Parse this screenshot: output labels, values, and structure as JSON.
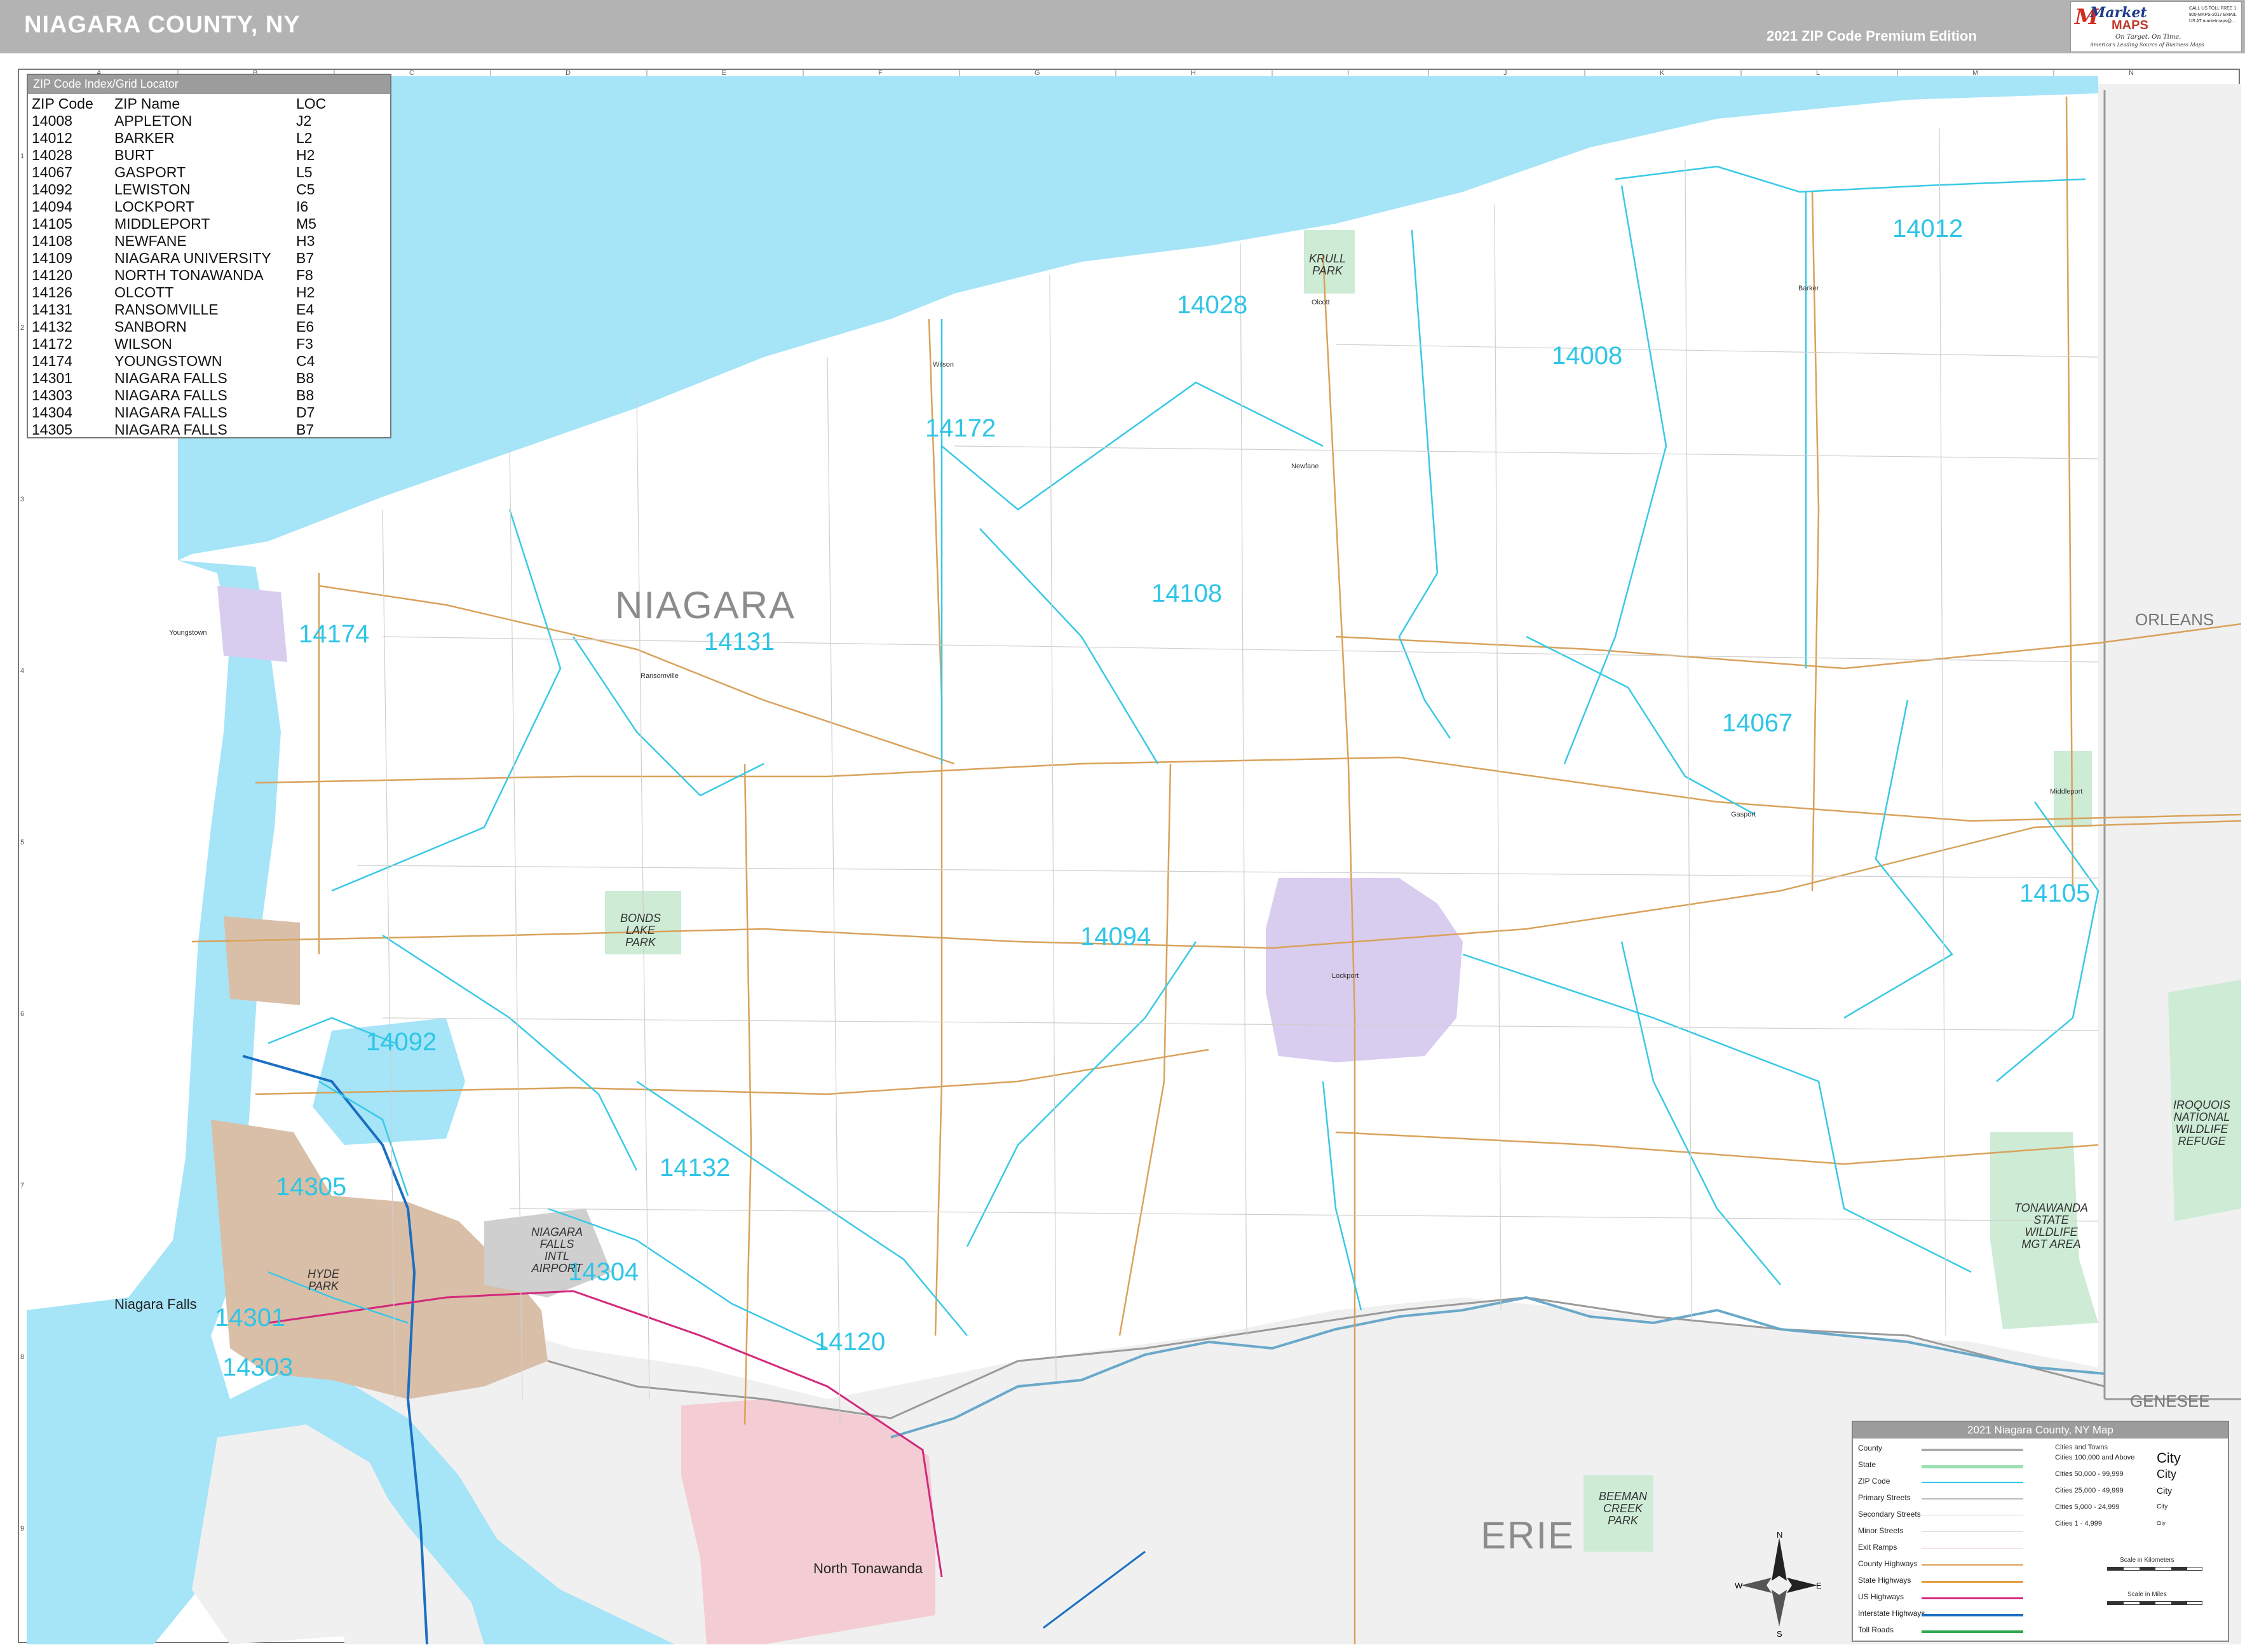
{
  "header": {
    "title": "NIAGARA COUNTY, NY",
    "edition": "2021 ZIP Code Premium Edition"
  },
  "logo": {
    "brand_line1": "Market",
    "brand_line2": "MAPS",
    "tagline": "On Target. On Time.",
    "tagline2": "America's Leading Source of Business Maps",
    "contact": "CALL US TOLL FREE 1-800-MAPS-2017 EMAIL US AT marketmaps@..."
  },
  "grid": {
    "columns": [
      "A",
      "B",
      "C",
      "D",
      "E",
      "F",
      "G",
      "H",
      "I",
      "J",
      "K",
      "L",
      "M",
      "N"
    ],
    "rows": [
      "1",
      "2",
      "3",
      "4",
      "5",
      "6",
      "7",
      "8",
      "9"
    ]
  },
  "zip_index": {
    "title": "ZIP Code Index/Grid Locator",
    "headers": [
      "ZIP Code",
      "ZIP Name",
      "LOC"
    ],
    "rows": [
      [
        "14008",
        "APPLETON",
        "J2"
      ],
      [
        "14012",
        "BARKER",
        "L2"
      ],
      [
        "14028",
        "BURT",
        "H2"
      ],
      [
        "14067",
        "GASPORT",
        "L5"
      ],
      [
        "14092",
        "LEWISTON",
        "C5"
      ],
      [
        "14094",
        "LOCKPORT",
        "I6"
      ],
      [
        "14105",
        "MIDDLEPORT",
        "M5"
      ],
      [
        "14108",
        "NEWFANE",
        "H3"
      ],
      [
        "14109",
        "NIAGARA UNIVERSITY",
        "B7"
      ],
      [
        "14120",
        "NORTH TONAWANDA",
        "F8"
      ],
      [
        "14126",
        "OLCOTT",
        "H2"
      ],
      [
        "14131",
        "RANSOMVILLE",
        "E4"
      ],
      [
        "14132",
        "SANBORN",
        "E6"
      ],
      [
        "14172",
        "WILSON",
        "F3"
      ],
      [
        "14174",
        "YOUNGSTOWN",
        "C4"
      ],
      [
        "14301",
        "NIAGARA FALLS",
        "B8"
      ],
      [
        "14303",
        "NIAGARA FALLS",
        "B8"
      ],
      [
        "14304",
        "NIAGARA FALLS",
        "D7"
      ],
      [
        "14305",
        "NIAGARA FALLS",
        "B7"
      ]
    ]
  },
  "zip_labels": {
    "z14012": "14012",
    "z14028": "14028",
    "z14008": "14008",
    "z14172": "14172",
    "z14108": "14108",
    "z14131": "14131",
    "z14174": "14174",
    "z14067": "14067",
    "z14105": "14105",
    "z14094": "14094",
    "z14092": "14092",
    "z14132": "14132",
    "z14305": "14305",
    "z14304": "14304",
    "z14301": "14301",
    "z14303": "14303",
    "z14120": "14120"
  },
  "counties": {
    "niagara": "NIAGARA",
    "erie": "ERIE",
    "orleans": "ORLEANS",
    "genesee": "GENESEE"
  },
  "parks": {
    "krull": "KRULL\nPARK",
    "iroquois": "IROQUOIS\nNATIONAL\nWILDLIFE\nREFUGE",
    "tonawanda": "TONAWANDA\nSTATE\nWILDLIFE\nMGT AREA",
    "beeman": "BEEMAN\nCREEK\nPARK",
    "bonds": "BONDS\nLAKE\nPARK",
    "hyde": "HYDE\nPARK",
    "airport": "NIAGARA\nFALLS\nINTL\nAIRPORT"
  },
  "cities": {
    "niagara_falls": "Niagara Falls",
    "north_tonawanda": "North Tonawanda",
    "lockport": "Lockport",
    "youngstown": "Youngstown",
    "ransomville": "Ransomville",
    "barker": "Barker",
    "newfane": "Newfane",
    "middleport": "Middleport",
    "gasport": "Gasport",
    "wilson": "Wilson",
    "olcott": "Olcott"
  },
  "legend": {
    "title": "2021 Niagara County, NY Map",
    "items": [
      "County",
      "State",
      "ZIP Code",
      "Primary Streets",
      "Secondary Streets",
      "Minor Streets",
      "Exit Ramps",
      "County Highways",
      "State Highways",
      "US Highways",
      "Interstate Highways",
      "Toll Roads"
    ],
    "cities_title": "Cities and Towns",
    "city_tiers": [
      "Cities 100,000 and Above",
      "Cities 50,000 - 99,999",
      "Cities 25,000 - 49,999",
      "Cities 5,000 - 24,999",
      "Cities 1 - 4,999"
    ],
    "city_samples": [
      "City",
      "City",
      "City",
      "City",
      "City"
    ],
    "scale_km": "Scale in Kilometers",
    "scale_mi": "Scale in Miles"
  },
  "compass": {
    "n": "N",
    "s": "S",
    "e": "E",
    "w": "W"
  },
  "colors": {
    "water": "#a6e4f8",
    "zip_boundary": "#38c9e6",
    "county_fill": "#f0f0f0",
    "niagara_falls_city": "#d9bfa8",
    "lockport_city": "#d8ccef",
    "north_tonawanda_city": "#f3cdd3",
    "park": "#cdebd5",
    "county_road": "#e0a050"
  }
}
